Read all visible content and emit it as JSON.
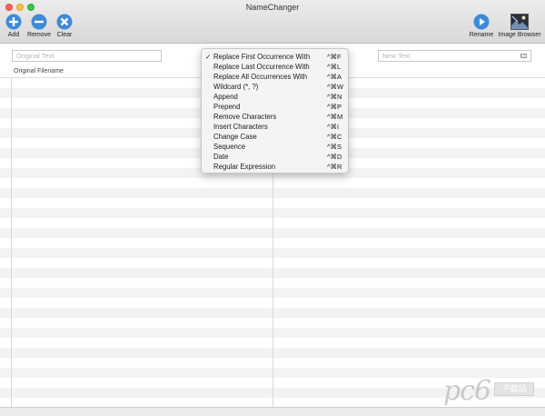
{
  "window": {
    "title": "NameChanger"
  },
  "toolbar": {
    "add_label": "Add",
    "remove_label": "Remove",
    "clear_label": "Clear",
    "rename_label": "Rename",
    "image_browser_label": "Image Browser"
  },
  "filters": {
    "original_placeholder": "Original Text",
    "new_placeholder": "New Text"
  },
  "table": {
    "columns": [
      "Original Filename",
      ""
    ]
  },
  "menu": {
    "items": [
      {
        "label": "Replace First Occurrence With",
        "shortcut": "^⌘F",
        "checked": "✓"
      },
      {
        "label": "Replace Last Occurrence With",
        "shortcut": "^⌘L",
        "checked": ""
      },
      {
        "label": "Replace All Occurrences With",
        "shortcut": "^⌘A",
        "checked": ""
      },
      {
        "label": "Wildcard (*, ?)",
        "shortcut": "^⌘W",
        "checked": ""
      },
      {
        "label": "Append",
        "shortcut": "^⌘N",
        "checked": ""
      },
      {
        "label": "Prepend",
        "shortcut": "^⌘P",
        "checked": ""
      },
      {
        "label": "Remove Characters",
        "shortcut": "^⌘M",
        "checked": ""
      },
      {
        "label": "Insert Characters",
        "shortcut": "^⌘I",
        "checked": ""
      },
      {
        "label": "Change Case",
        "shortcut": "^⌘C",
        "checked": ""
      },
      {
        "label": "Sequence",
        "shortcut": "^⌘S",
        "checked": ""
      },
      {
        "label": "Date",
        "shortcut": "^⌘D",
        "checked": ""
      },
      {
        "label": "Regular Expression",
        "shortcut": "^⌘R",
        "checked": ""
      }
    ]
  },
  "watermark": {
    "text": "pc6",
    "box": "下载站"
  },
  "colors": {
    "toolbar_blue": "#3f8ad8",
    "accent_blue": "#2f7fd6"
  }
}
